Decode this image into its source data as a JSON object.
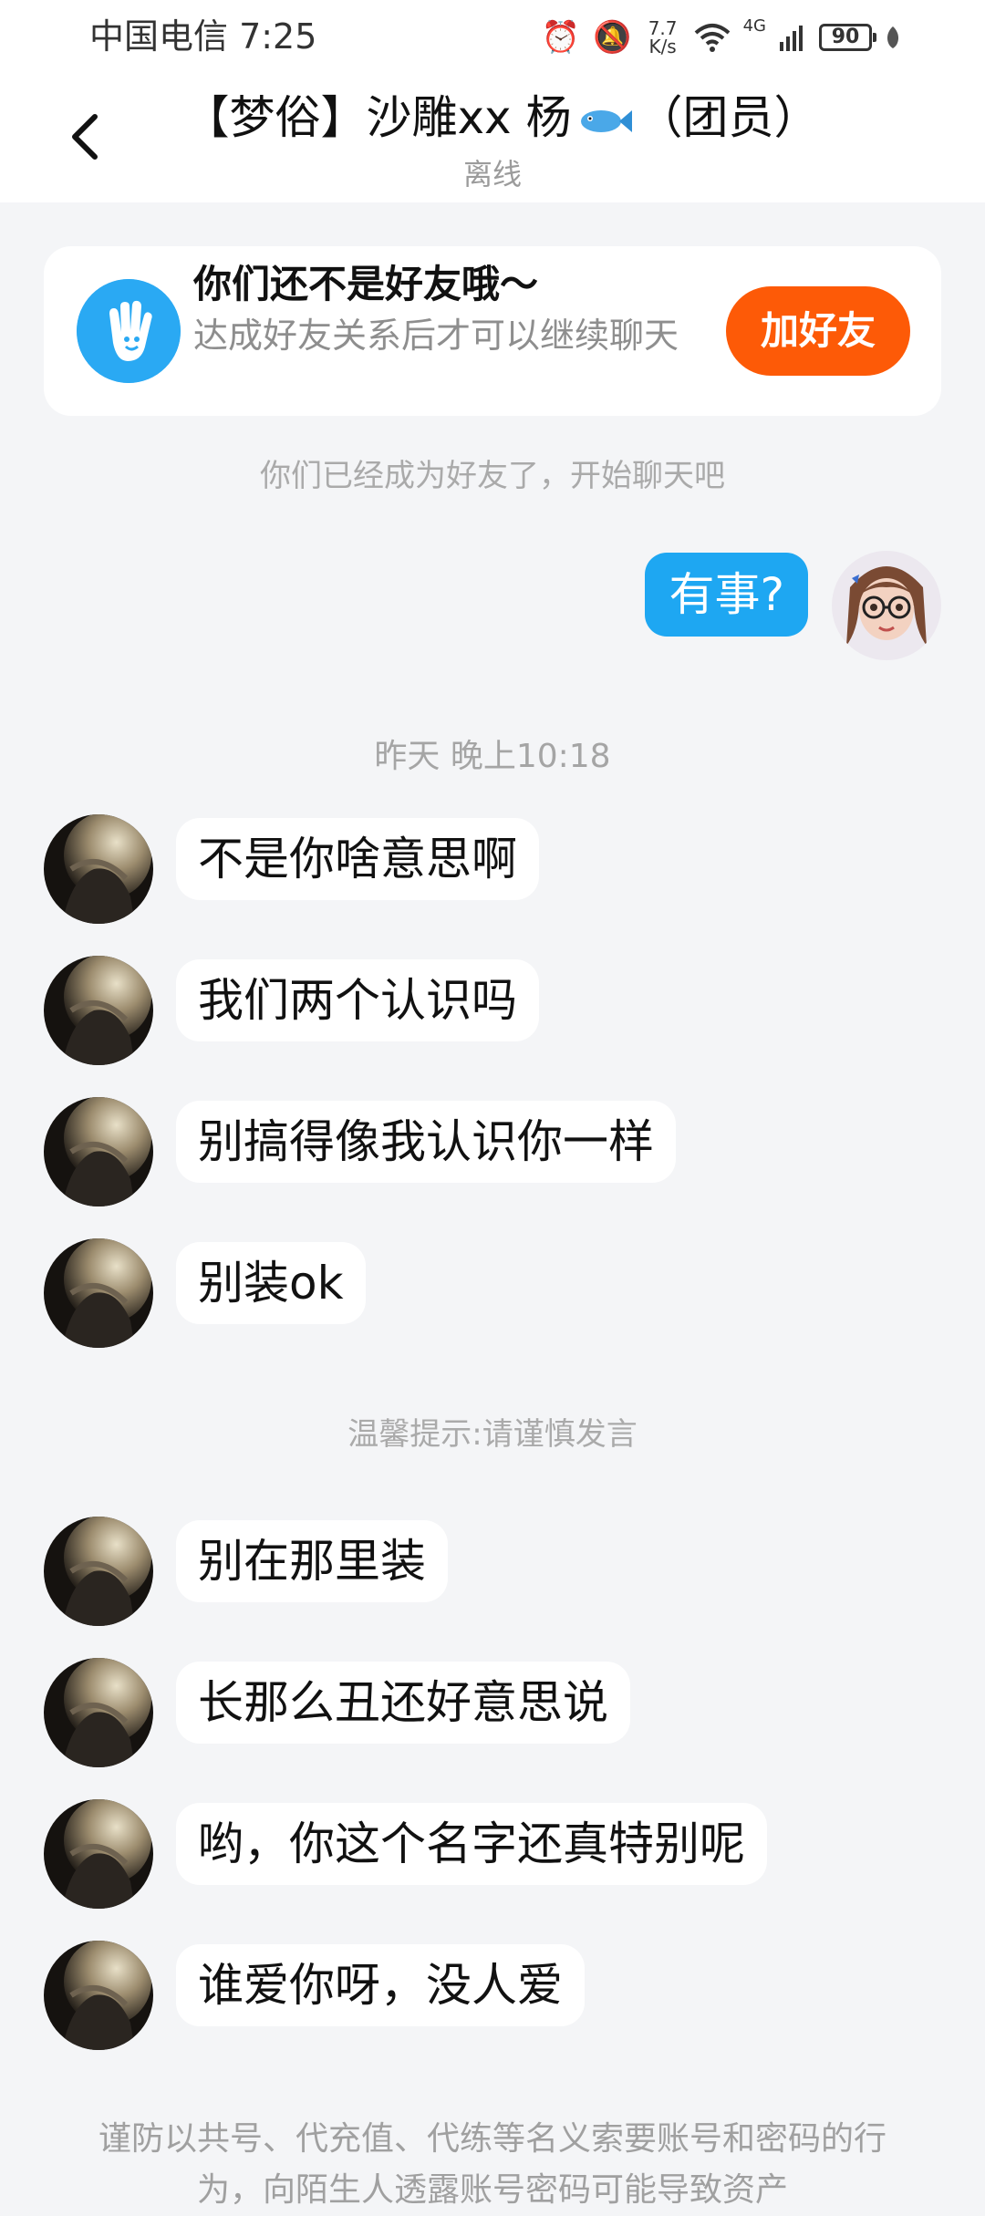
{
  "status_bar": {
    "carrier_time": "中国电信 7:25",
    "net_speed_value": "7.7",
    "net_speed_unit": "K/s",
    "network": "4G",
    "battery": "90"
  },
  "header": {
    "title_prefix": "【梦俗】沙雕xx 杨",
    "title_suffix": "（团员）",
    "status": "离线"
  },
  "friend_card": {
    "title": "你们还不是好友哦～",
    "description": "达成好友关系后才可以继续聊天",
    "button_label": "加好友"
  },
  "notes": {
    "became_friends": "你们已经成为好友了，开始聊天吧",
    "timestamp": "昨天 晚上10:18",
    "reminder": "温馨提示:请谨慎发言",
    "security_warning": "谨防以共号、代充值、代练等名义索要账号和密码的行为，向陌生人透露账号密码可能导致资产"
  },
  "my_message": "有事?",
  "peer_messages_group1": [
    "不是你啥意思啊",
    "我们两个认识吗",
    "别搞得像我认识你一样",
    "别装ok"
  ],
  "peer_messages_group2": [
    "别在那里装",
    "长那么丑还好意思说",
    "哟，你这个名字还真特别呢",
    "谁爱你呀，没人爱"
  ],
  "colors": {
    "accent_blue": "#1ea7f2",
    "add_friend_orange": "#fd5a07",
    "page_background": "#f4f5f7"
  }
}
